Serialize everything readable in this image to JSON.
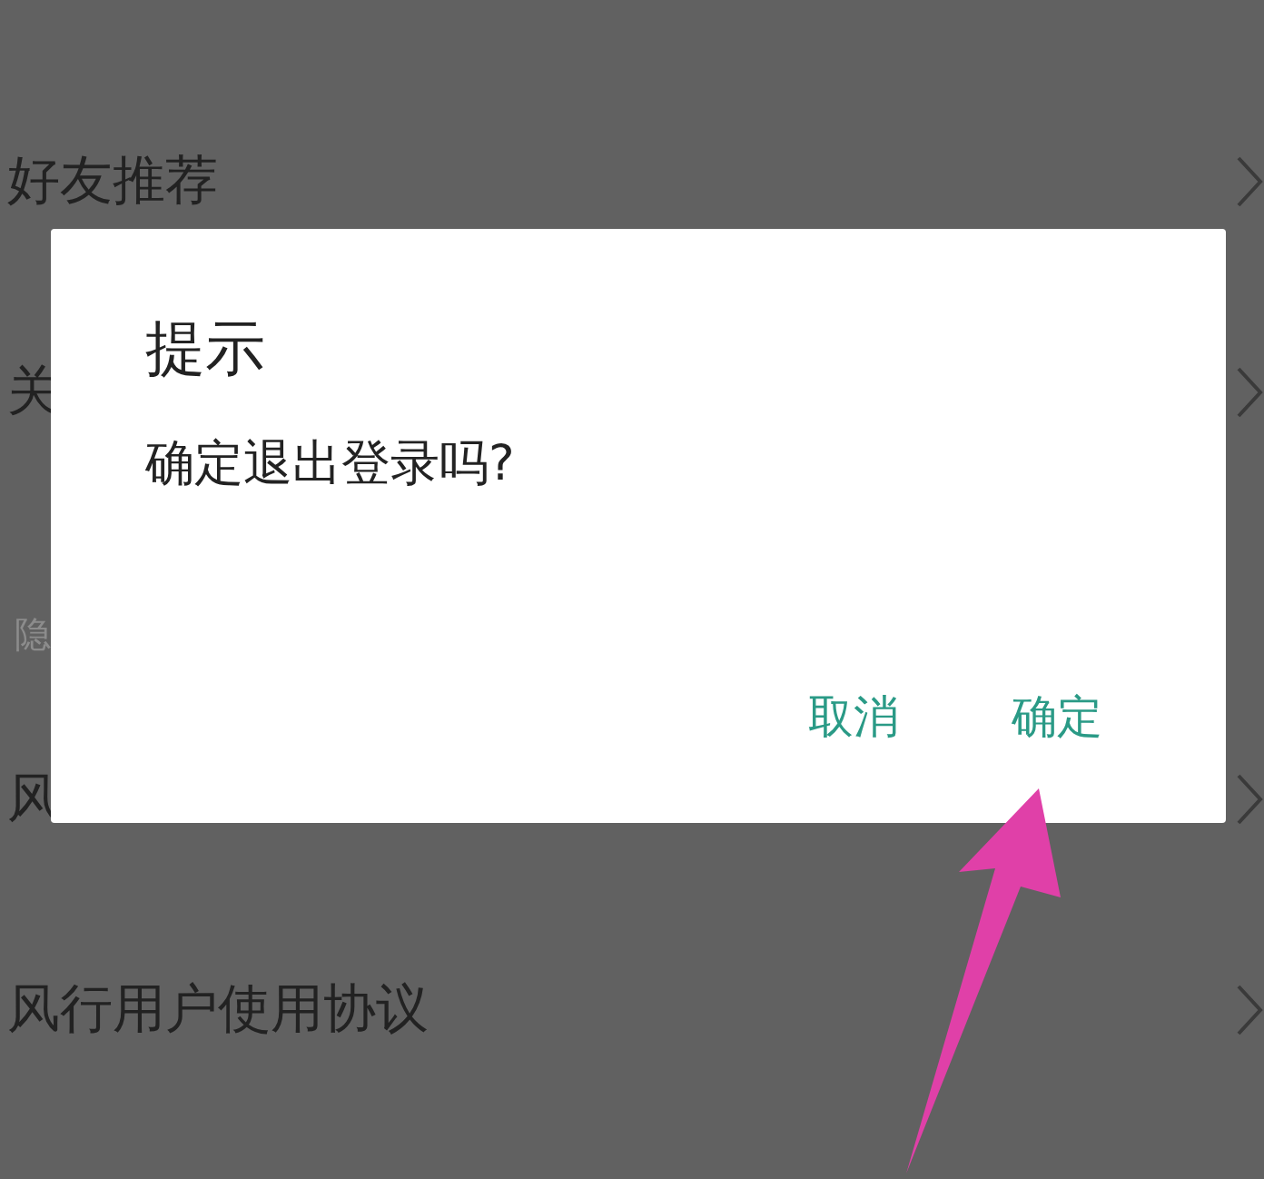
{
  "settings_list": [
    {
      "kind": "item",
      "label": "好友推荐"
    },
    {
      "kind": "item",
      "label": "关"
    },
    {
      "kind": "header",
      "label": "隐"
    },
    {
      "kind": "item",
      "label": "风"
    },
    {
      "kind": "item",
      "label": "风行用户使用协议"
    }
  ],
  "dialog": {
    "title": "提示",
    "message": "确定退出登录吗?",
    "buttons": [
      "取消",
      "确定"
    ]
  }
}
